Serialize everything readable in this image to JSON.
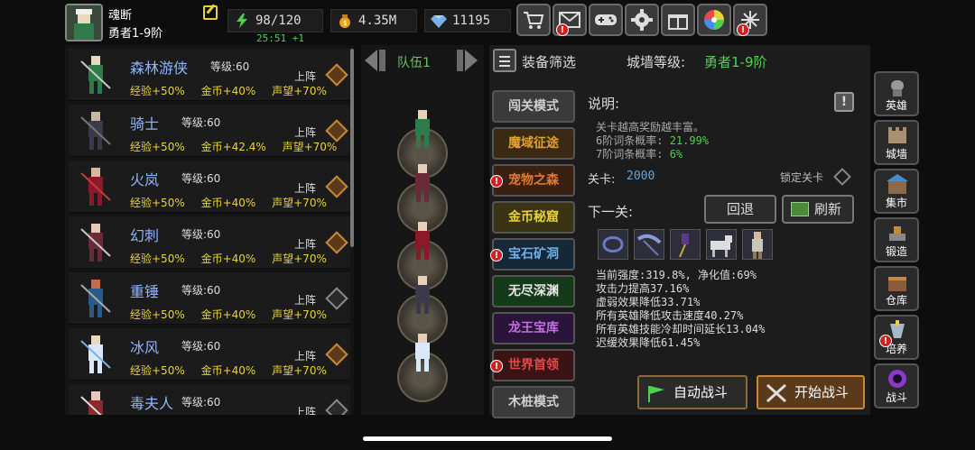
{
  "player": {
    "name": "魂断",
    "rank": "勇者1-9阶"
  },
  "resources": {
    "energy": "98/120",
    "energy_timer": "25:51 +1",
    "gold": "4.35M",
    "gems": "11195"
  },
  "top_buttons": [
    "shop-cart",
    "mail",
    "gamepad",
    "settings",
    "gift",
    "spin-wheel",
    "event"
  ],
  "heroes": [
    {
      "name": "森林游侠",
      "level_label": "等级:",
      "level": "60",
      "exp": "经验+50%",
      "gold": "金币+40%",
      "fame": "声望+70%",
      "deploy": "上阵",
      "active": true
    },
    {
      "name": "骑士",
      "level_label": "等级:",
      "level": "60",
      "exp": "经验+50%",
      "gold": "金币+42.4%",
      "fame": "声望+70%",
      "deploy": "上阵",
      "active": true
    },
    {
      "name": "火岚",
      "level_label": "等级:",
      "level": "60",
      "exp": "经验+50%",
      "gold": "金币+40%",
      "fame": "声望+70%",
      "deploy": "上阵",
      "active": true
    },
    {
      "name": "幻刺",
      "level_label": "等级:",
      "level": "60",
      "exp": "经验+50%",
      "gold": "金币+40%",
      "fame": "声望+70%",
      "deploy": "上阵",
      "active": true
    },
    {
      "name": "重锤",
      "level_label": "等级:",
      "level": "60",
      "exp": "经验+50%",
      "gold": "金币+40%",
      "fame": "声望+70%",
      "deploy": "上阵",
      "active": false
    },
    {
      "name": "冰风",
      "level_label": "等级:",
      "level": "60",
      "exp": "经验+50%",
      "gold": "金币+40%",
      "fame": "声望+70%",
      "deploy": "上阵",
      "active": true
    },
    {
      "name": "毒夫人",
      "level_label": "等级:",
      "level": "60",
      "exp": "",
      "gold": "",
      "fame": "",
      "deploy": "上阵",
      "active": false
    }
  ],
  "team": {
    "label": "队伍1"
  },
  "panel": {
    "filter_label": "装备筛选",
    "wall_label": "城墙等级:",
    "wall_value": "勇者1-9阶",
    "desc_title": "说明:",
    "help": "!",
    "desc_lines": [
      {
        "text": "关卡越高奖励越丰富。",
        "value": ""
      },
      {
        "text": "6阶词条概率:",
        "value": "21.99%"
      },
      {
        "text": "7阶词条概率:",
        "value": "6%"
      }
    ],
    "stage_label": "关卡:",
    "stage_value": "2000",
    "lock_label": "锁定关卡",
    "next_label": "下一关:",
    "back_label": "回退",
    "refresh_label": "刷新",
    "effects": [
      "当前强度:319.8%, 净化值:69%",
      "攻击力提高37.16%",
      "虚弱效果降低33.71%",
      "所有英雄降低攻击速度40.27%",
      "所有英雄技能冷却时间延长13.04%",
      "迟缓效果降低61.45%"
    ],
    "auto_battle": "自动战斗",
    "start_battle": "开始战斗"
  },
  "modes": [
    {
      "label": "闯关模式",
      "color": "#cfcfcf",
      "bg": "#3a3a3a",
      "alert": false
    },
    {
      "label": "魔域征途",
      "color": "#e0a030",
      "bg": "#3a2a14",
      "alert": false
    },
    {
      "label": "宠物之森",
      "color": "#e07a30",
      "bg": "#3a2010",
      "alert": true
    },
    {
      "label": "金币秘窟",
      "color": "#e8d23a",
      "bg": "#3a3414",
      "alert": false
    },
    {
      "label": "宝石矿洞",
      "color": "#6fb0e8",
      "bg": "#142838",
      "alert": true
    },
    {
      "label": "无尽深渊",
      "color": "#e8e8e8",
      "bg": "#143a1a",
      "alert": false
    },
    {
      "label": "龙王宝库",
      "color": "#c070e0",
      "bg": "#2a143a",
      "alert": false
    },
    {
      "label": "世界首领",
      "color": "#e04a4a",
      "bg": "#3a1414",
      "alert": true
    },
    {
      "label": "木桩模式",
      "color": "#cfcfcf",
      "bg": "#3a3a3a",
      "alert": false
    }
  ],
  "nav": [
    {
      "label": "英雄",
      "alert": false
    },
    {
      "label": "城墙",
      "alert": false
    },
    {
      "label": "集市",
      "alert": false
    },
    {
      "label": "锻造",
      "alert": false
    },
    {
      "label": "仓库",
      "alert": false
    },
    {
      "label": "培养",
      "alert": true
    },
    {
      "label": "战斗",
      "alert": false
    }
  ]
}
